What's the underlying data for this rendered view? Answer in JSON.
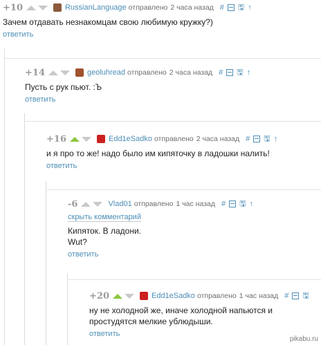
{
  "labels": {
    "sent": "отправлено",
    "reply": "ответить",
    "hide_comment": "скрыть комментарий",
    "tool_hash": "#",
    "tool_up": "↑",
    "tool_save": "🖫"
  },
  "comments": [
    {
      "rating": "+10",
      "author": "RussianLanguage",
      "time": "2 часа назад",
      "avatar_color": "#8b5a3c",
      "text": [
        "Зачем отдавать незнакомцам свою любимую кружку?)"
      ]
    },
    {
      "rating": "+14",
      "author": "geoluhread",
      "time": "2 часа назад",
      "avatar_color": "#a0522d",
      "text": [
        "Пусть с рук пьют. :Ъ"
      ]
    },
    {
      "rating": "+16",
      "author": "Edd1eSadko",
      "time": "2 часа назад",
      "avatar_color": "#cc2020",
      "upvoted": true,
      "text": [
        "и я про то же! надо было им кипяточку в ладошки налить!"
      ]
    },
    {
      "rating": "-6",
      "author": "Vlad01",
      "time": "1 час назад",
      "collapsible": true,
      "text": [
        "Кипяток. В ладони.",
        "Wut?"
      ]
    },
    {
      "rating": "+20",
      "author": "Edd1eSadko",
      "time": "1 час назад",
      "avatar_color": "#cc2020",
      "upvoted": true,
      "text": [
        "ну не холодной же, иначе холодной напьются и",
        "простудятся мелкие ублюдыши."
      ]
    }
  ],
  "watermark": "pikabu.ru",
  "colors": {
    "accent": "#4d8eb6",
    "upvote": "#8cc63f",
    "rating": "#9a9a9a"
  }
}
